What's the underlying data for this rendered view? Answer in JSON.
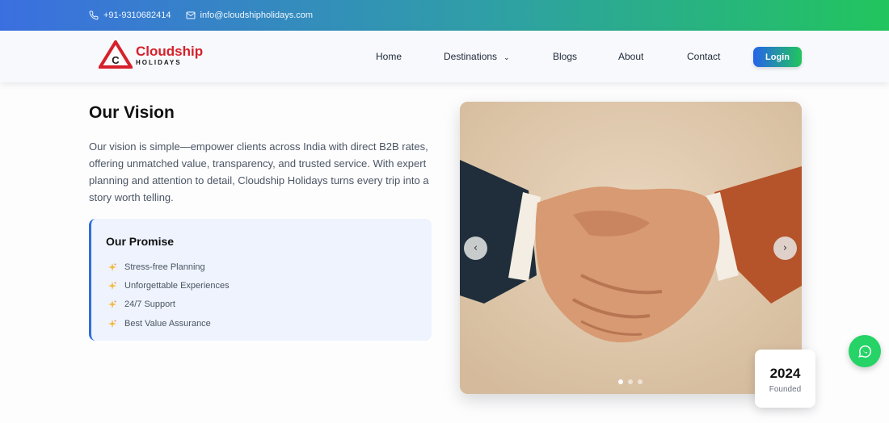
{
  "topbar": {
    "phone": "+91-9310682414",
    "email": "info@cloudshipholidays.com",
    "phone_icon": "phone-icon",
    "email_icon": "mail-icon"
  },
  "brand": {
    "name": "Cloudship",
    "sub": "HOLIDAYS",
    "mark_letter": "C",
    "color": "#d6202b"
  },
  "nav": {
    "home": "Home",
    "destinations": "Destinations",
    "blogs": "Blogs",
    "about": "About",
    "contact": "Contact",
    "login": "Login"
  },
  "vision": {
    "title": "Our Vision",
    "text": "Our vision is simple—empower clients across India with direct B2B rates, offering unmatched value, transparency, and trusted service. With expert planning and attention to detail, Cloudship Holidays turns every trip into a story worth telling."
  },
  "promise": {
    "title": "Our Promise",
    "items": [
      "Stress-free Planning",
      "Unforgettable Experiences",
      "24/7 Support",
      "Best Value Assurance"
    ],
    "accent": "#2e6fd6"
  },
  "carousel": {
    "image": "handshake photo",
    "slides": 3,
    "active_slide": 1
  },
  "founded": {
    "year": "2024",
    "label": "Founded"
  },
  "colors": {
    "gradient_start": "#3b6fe0",
    "gradient_end": "#22c55e",
    "whatsapp": "#25d366"
  }
}
